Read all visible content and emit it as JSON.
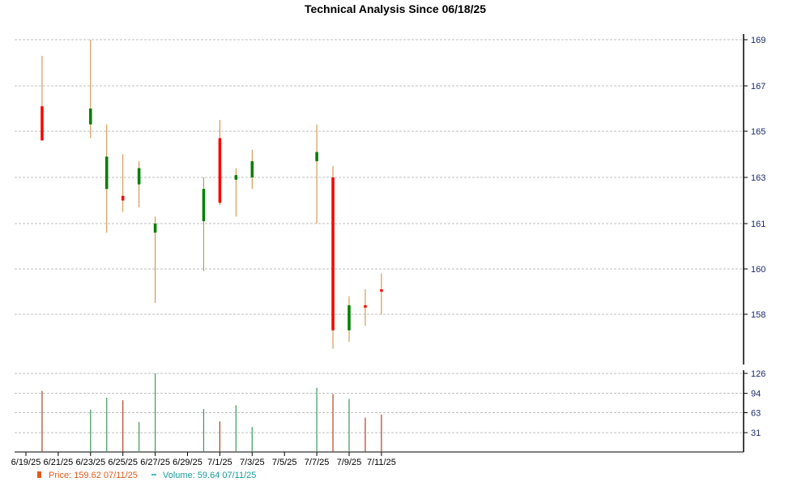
{
  "chart_data": {
    "type": "candlestick",
    "title": "Technical Analysis Since 06/18/25",
    "price_axis": {
      "min": 156,
      "max": 169,
      "ticks": [
        "169",
        "167",
        "165",
        "163",
        "161",
        "160",
        "158"
      ]
    },
    "volume_axis": {
      "min": 0,
      "max": 126,
      "ticks": [
        "126",
        "94",
        "63",
        "31"
      ]
    },
    "x_ticks": [
      "6/19/25",
      "6/21/25",
      "6/23/25",
      "6/25/25",
      "6/27/25",
      "6/29/25",
      "7/1/25",
      "7/3/25",
      "7/5/25",
      "7/7/25",
      "7/9/25",
      "7/11/25"
    ],
    "candles": [
      {
        "date": "6/20/25",
        "open": 166.1,
        "high": 168.3,
        "low": 164.6,
        "close": 164.6,
        "volume": 98
      },
      {
        "date": "6/23/25",
        "open": 165.3,
        "high": 169.0,
        "low": 164.7,
        "close": 166.0,
        "volume": 68
      },
      {
        "date": "6/24/25",
        "open": 162.5,
        "high": 165.3,
        "low": 160.8,
        "close": 163.9,
        "volume": 87
      },
      {
        "date": "6/25/25",
        "open": 162.2,
        "high": 164.0,
        "low": 161.5,
        "close": 162.0,
        "volume": 83
      },
      {
        "date": "6/26/25",
        "open": 162.7,
        "high": 163.7,
        "low": 161.7,
        "close": 163.4,
        "volume": 48
      },
      {
        "date": "6/27/25",
        "open": 160.8,
        "high": 161.3,
        "low": 158.5,
        "close": 161.0,
        "volume": 126
      },
      {
        "date": "6/30/25",
        "open": 161.1,
        "high": 163.0,
        "low": 159.9,
        "close": 162.5,
        "volume": 69
      },
      {
        "date": "7/1/25",
        "open": 164.7,
        "high": 165.5,
        "low": 161.8,
        "close": 161.9,
        "volume": 49
      },
      {
        "date": "7/2/25",
        "open": 162.9,
        "high": 163.4,
        "low": 161.3,
        "close": 163.1,
        "volume": 75
      },
      {
        "date": "7/3/25",
        "open": 163.0,
        "high": 164.2,
        "low": 162.5,
        "close": 163.7,
        "volume": 40
      },
      {
        "date": "7/7/25",
        "open": 163.7,
        "high": 165.3,
        "low": 161.0,
        "close": 164.1,
        "volume": 103
      },
      {
        "date": "7/8/25",
        "open": 163.0,
        "high": 163.5,
        "low": 156.5,
        "close": 157.3,
        "volume": 93
      },
      {
        "date": "7/9/25",
        "open": 157.3,
        "high": 158.8,
        "low": 156.8,
        "close": 158.4,
        "volume": 85
      },
      {
        "date": "7/10/25",
        "open": 158.4,
        "high": 159.1,
        "low": 157.5,
        "close": 158.3,
        "volume": 55
      },
      {
        "date": "7/11/25",
        "open": 159.1,
        "high": 159.8,
        "low": 158.0,
        "close": 159.0,
        "volume": 60
      }
    ],
    "legend": [
      {
        "label": "Price: 159.62  07/11/25",
        "color": "#e05a1a"
      },
      {
        "label": "Volume: 59.64  07/11/25",
        "color": "#1a9a9a"
      }
    ],
    "colors": {
      "up": "#008000",
      "down": "#ff0000",
      "wick": "#cc8833",
      "volume_up": "#3a9a5a",
      "volume_down": "#b04020",
      "axis_label": "#1a2a6c",
      "grid": "#aaaaaa"
    },
    "grid": true
  }
}
